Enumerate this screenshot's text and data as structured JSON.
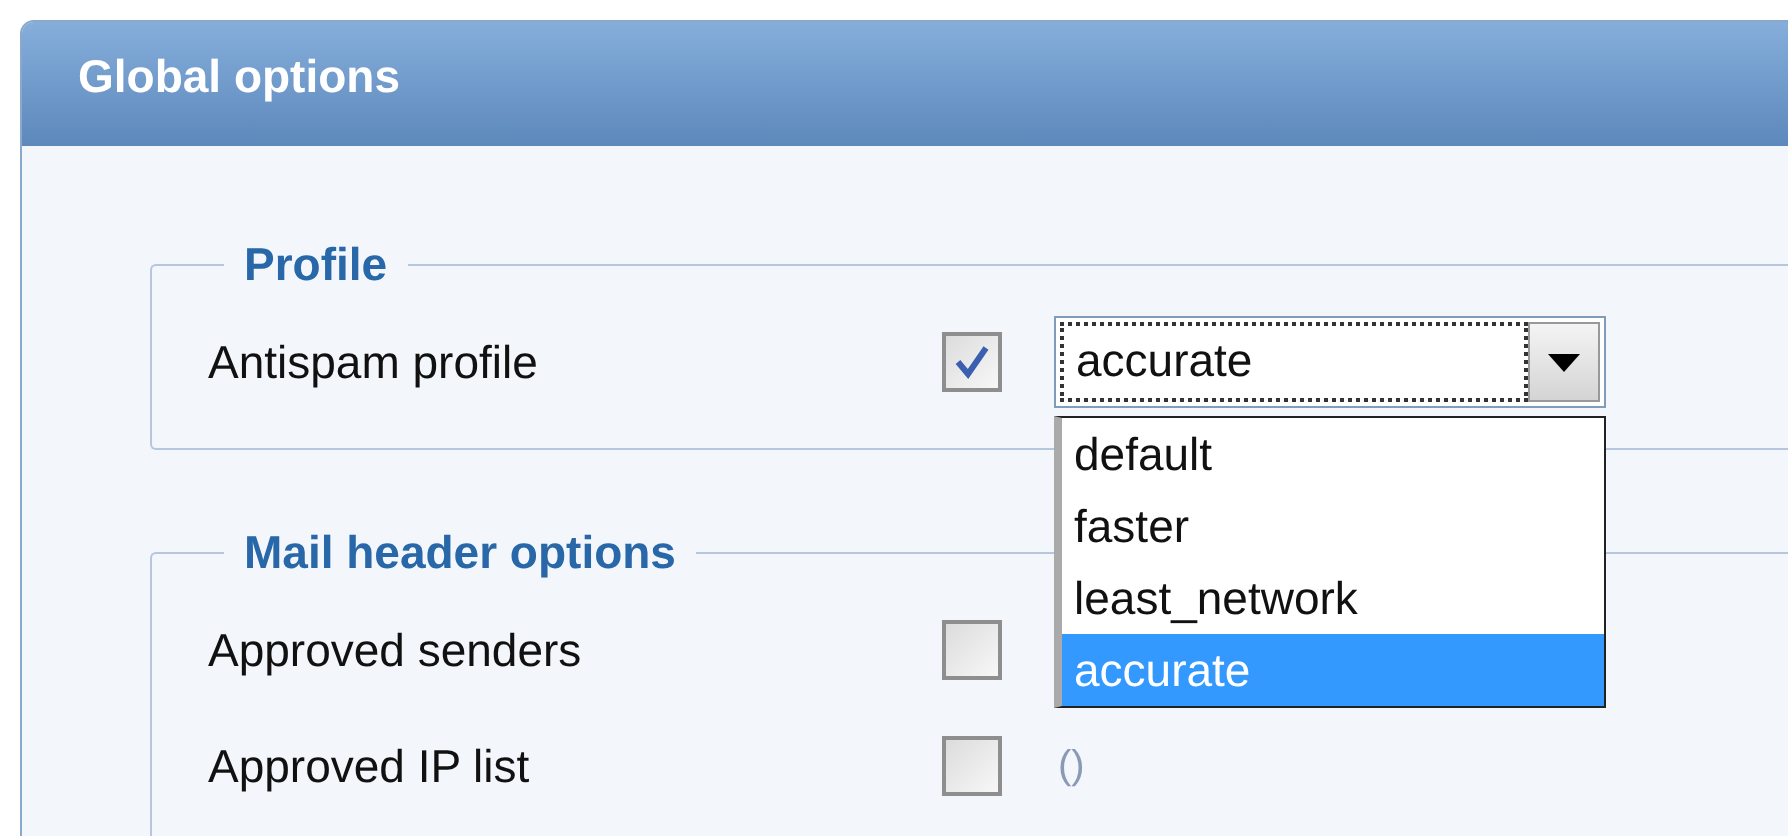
{
  "panel": {
    "title": "Global options"
  },
  "sections": [
    {
      "legend": "Profile",
      "rows": [
        {
          "label": "Antispam profile",
          "checked": true,
          "select": {
            "value": "accurate",
            "expanded": true,
            "options": [
              {
                "label": "default",
                "selected": false
              },
              {
                "label": "faster",
                "selected": false
              },
              {
                "label": "least_network",
                "selected": false
              },
              {
                "label": "accurate",
                "selected": true
              }
            ]
          }
        }
      ]
    },
    {
      "legend": "Mail header options",
      "rows": [
        {
          "label": "Approved senders",
          "checked": false
        },
        {
          "label": "Approved IP list",
          "checked": false,
          "note": "()"
        }
      ]
    }
  ]
}
